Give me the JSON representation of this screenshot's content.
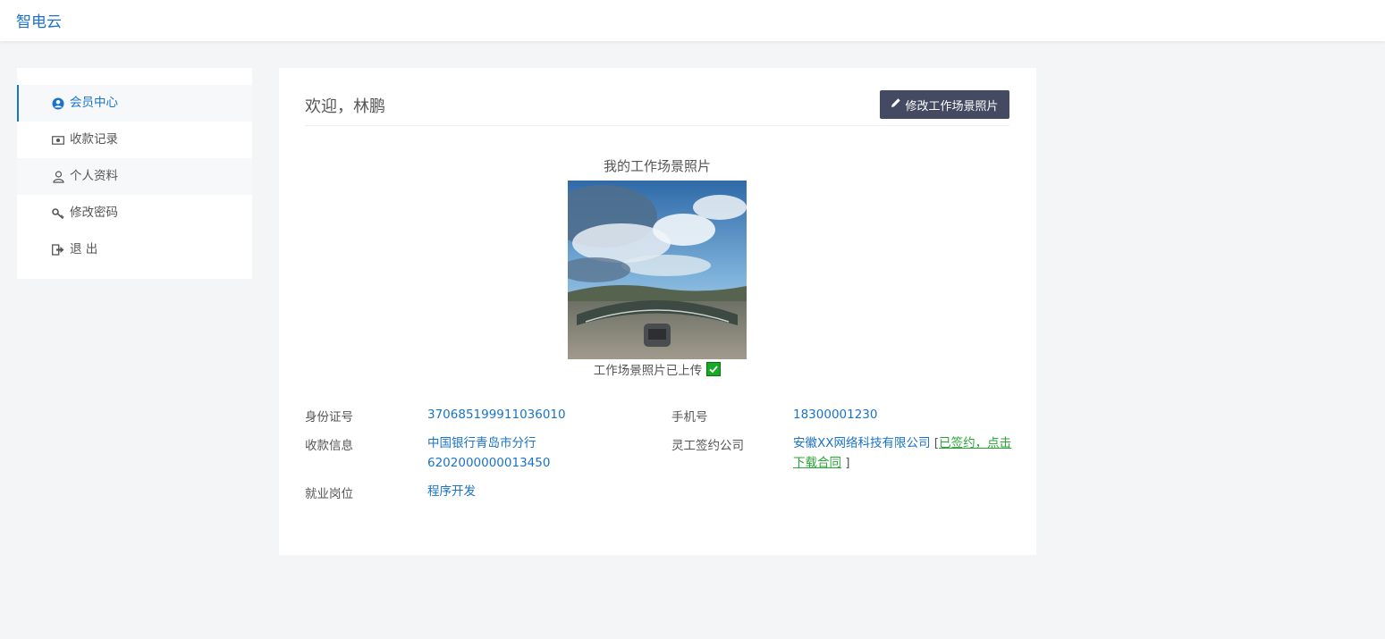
{
  "header": {
    "brand": "智电云"
  },
  "sidebar": {
    "items": [
      {
        "label": "会员中心",
        "icon": "user-circle-icon",
        "active": true
      },
      {
        "label": "收款记录",
        "icon": "money-icon"
      },
      {
        "label": "个人资料",
        "icon": "user-icon"
      },
      {
        "label": "修改密码",
        "icon": "key-icon"
      },
      {
        "label": "退 出",
        "icon": "logout-icon"
      }
    ]
  },
  "main": {
    "welcome": "欢迎，林鹏",
    "edit_photo_button": "修改工作场景照片",
    "photo_title": "我的工作场景照片",
    "photo_status": "工作场景照片已上传",
    "info": {
      "id_label": "身份证号",
      "id_value": "370685199911036010",
      "phone_label": "手机号",
      "phone_value": "18300001230",
      "payment_label": "收款信息",
      "payment_bank": "中国银行青岛市分行",
      "payment_account": "6202000000013450",
      "company_label": "灵工签约公司",
      "company_name": "安徽XX网络科技有限公司",
      "contract_open": "[",
      "contract_link": "已签约，点击下载合同",
      "contract_close": "]",
      "position_label": "就业岗位",
      "position_value": "程序开发"
    }
  },
  "colors": {
    "accent": "#1a73c8",
    "button_bg": "#434a62",
    "success": "#2aa538"
  }
}
